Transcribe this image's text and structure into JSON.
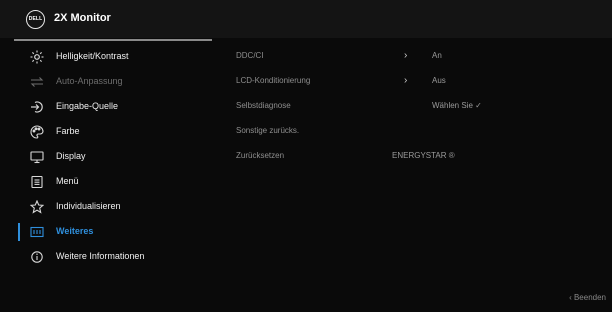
{
  "header": {
    "logo": "DELL",
    "title": "2X Monitor"
  },
  "menu": [
    {
      "label": "Helligkeit/Kontrast",
      "icon": "brightness-icon"
    },
    {
      "label": "Auto-Anpassung",
      "icon": "auto-adjust-icon"
    },
    {
      "label": "Eingabe-Quelle",
      "icon": "input-source-icon"
    },
    {
      "label": "Farbe",
      "icon": "color-palette-icon"
    },
    {
      "label": "Display",
      "icon": "display-icon"
    },
    {
      "label": "Menü",
      "icon": "menu-icon"
    },
    {
      "label": "Individualisieren",
      "icon": "star-icon"
    },
    {
      "label": "Weiteres",
      "icon": "others-icon"
    },
    {
      "label": "Weitere Informationen",
      "icon": "info-icon"
    }
  ],
  "active_item": "Weiteres",
  "panel": [
    {
      "name": "DDC/CI",
      "chevron": "›",
      "value": "An"
    },
    {
      "name": "LCD-Konditionierung",
      "chevron": "›",
      "value": "Aus"
    },
    {
      "name": "Selbstdiagnose",
      "value": "Wählen Sie ✓"
    },
    {
      "name": "Sonstige zurücks."
    },
    {
      "name": "Zurücksetzen",
      "value": "ENERGYSTAR ®"
    }
  ],
  "footer": {
    "exit_label": "‹ Beenden"
  },
  "colors": {
    "accent": "#2f8fdc",
    "background": "#0a0a0a"
  }
}
